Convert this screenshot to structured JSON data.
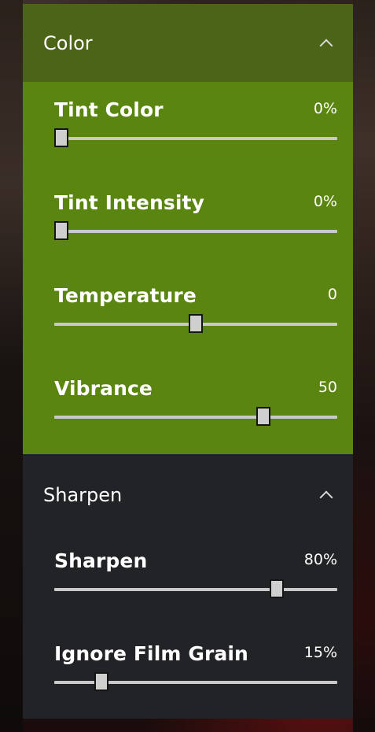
{
  "sections": {
    "color": {
      "title": "Color",
      "sliders": [
        {
          "label": "Tint Color",
          "value": "0%",
          "fraction": 0.0
        },
        {
          "label": "Tint Intensity",
          "value": "0%",
          "fraction": 0.0
        },
        {
          "label": "Temperature",
          "value": "0",
          "fraction": 0.5
        },
        {
          "label": "Vibrance",
          "value": "50",
          "fraction": 0.75
        }
      ]
    },
    "sharpen": {
      "title": "Sharpen",
      "sliders": [
        {
          "label": "Sharpen",
          "value": "80%",
          "fraction": 0.8
        },
        {
          "label": "Ignore Film Grain",
          "value": "15%",
          "fraction": 0.15
        }
      ]
    }
  },
  "colors": {
    "panel_bg": "#222327",
    "color_header_bg": "#4b6418",
    "color_body_bg": "#5a8510",
    "track": "#c9c9c9",
    "thumb": "#cfcfcf"
  },
  "icons": {
    "collapse": "chevron-up-icon"
  }
}
